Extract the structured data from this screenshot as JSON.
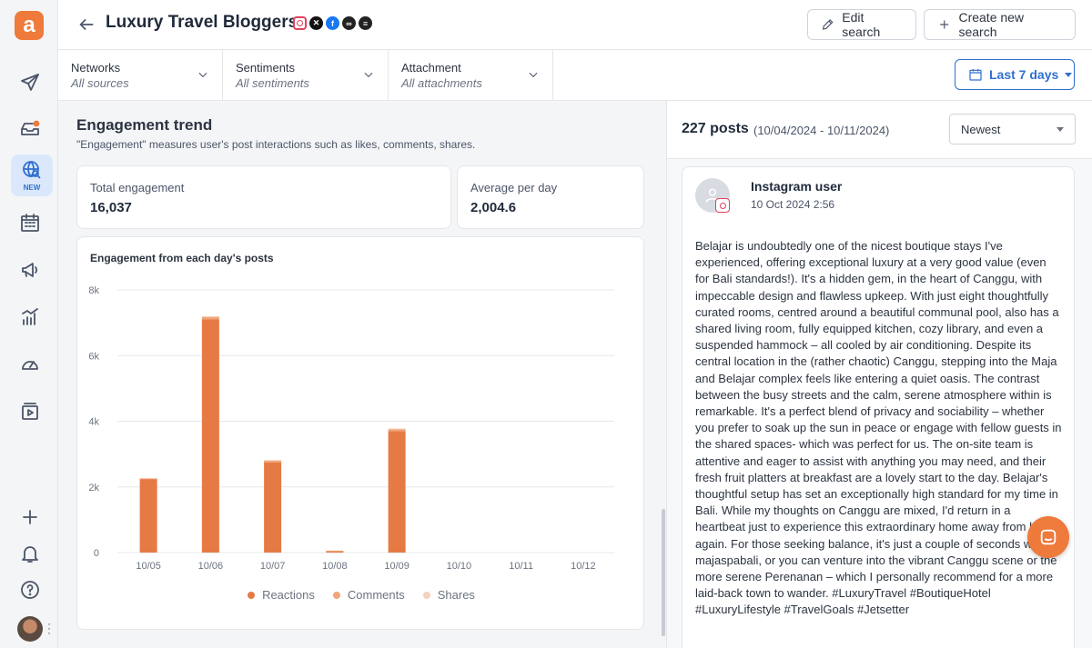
{
  "app": {
    "logo_letter": "a",
    "accent": "#ee7a3b",
    "primary": "#2f6fd0"
  },
  "sidebar": {
    "items": [
      {
        "icon": "send-icon"
      },
      {
        "icon": "inbox-icon"
      },
      {
        "icon": "globe-search-icon",
        "badge": "NEW",
        "active": true
      },
      {
        "icon": "calendar-icon"
      },
      {
        "icon": "megaphone-icon"
      },
      {
        "icon": "analytics-icon"
      },
      {
        "icon": "gauge-icon"
      },
      {
        "icon": "media-library-icon"
      }
    ],
    "bottom": [
      "plus-icon",
      "bell-icon",
      "help-icon",
      "avatar"
    ]
  },
  "header": {
    "title": "Luxury Travel Bloggers",
    "networks": [
      "instagram-icon",
      "x-icon",
      "facebook-icon",
      "tripadvisor-icon",
      "blog-icon"
    ],
    "edit_label": "Edit search",
    "create_label": "Create new search"
  },
  "filters": {
    "networks": {
      "label": "Networks",
      "value": "All sources"
    },
    "sentiments": {
      "label": "Sentiments",
      "value": "All sentiments"
    },
    "attachment": {
      "label": "Attachment",
      "value": "All attachments"
    },
    "date_range": "Last 7 days"
  },
  "engagement": {
    "title": "Engagement trend",
    "subtitle": "\"Engagement\" measures user's post interactions such as likes, comments, shares.",
    "total_label": "Total engagement",
    "total_value": "16,037",
    "avg_label": "Average per day",
    "avg_value": "2,004.6"
  },
  "chart_data": {
    "type": "bar",
    "title": "Engagement from each day's posts",
    "categories": [
      "10/05",
      "10/06",
      "10/07",
      "10/08",
      "10/09",
      "10/10",
      "10/11",
      "10/12"
    ],
    "series": [
      {
        "name": "Reactions",
        "color": "#e57a45",
        "values": [
          2250,
          7100,
          2750,
          50,
          3700,
          0,
          0,
          0
        ]
      },
      {
        "name": "Comments",
        "color": "#f0a57a",
        "values": [
          10,
          80,
          60,
          10,
          60,
          0,
          0,
          0
        ]
      },
      {
        "name": "Shares",
        "color": "#f7d0bb",
        "values": [
          0,
          20,
          10,
          0,
          20,
          0,
          0,
          0
        ]
      }
    ],
    "stacked": true,
    "yticks": [
      "0",
      "2k",
      "4k",
      "6k",
      "8k"
    ],
    "ylim": [
      0,
      8000
    ],
    "grid": true,
    "legend": "bottom"
  },
  "posts": {
    "count": "227 posts",
    "range": "(10/04/2024 - 10/11/2024)",
    "sort": "Newest",
    "items": [
      {
        "user": "Instagram user",
        "time": "10 Oct 2024 2:56",
        "text": "Belajar is undoubtedly one of the nicest boutique stays I've experienced, offering exceptional luxury at a very good value (even for Bali standards!). It's a hidden gem, in the heart of Canggu, with impeccable design and flawless upkeep. With just eight thoughtfully curated rooms, centred around a beautiful communal pool, also has a shared living room, fully equipped kitchen, cozy library, and even a suspended hammock – all cooled by air conditioning. Despite its central location in the (rather chaotic) Canggu, stepping into the Maja and Belajar complex feels like entering a quiet oasis. The contrast between the busy streets and the calm, serene atmosphere within is remarkable. It's a perfect blend of privacy and sociability – whether you prefer to soak up the sun in peace or engage with fellow guests in the shared spaces- which was perfect for us. The on-site team is attentive and eager to assist with anything you may need, and their fresh fruit platters at breakfast are a lovely start to the day. Belajar's thoughtful setup has set an exceptionally high standard for my time in Bali. While my thoughts on Canggu are mixed, I'd return in a heartbeat just to experience this extraordinary home away from home again. For those seeking balance, it's just a couple of seconds walk to majaspabali, or you can venture into the vibrant Canggu scene or the more serene Perenanan – which I personally recommend for a more laid-back town to wander. #LuxuryTravel #BoutiqueHotel #LuxuryLifestyle #TravelGoals #Jetsetter"
      }
    ]
  }
}
